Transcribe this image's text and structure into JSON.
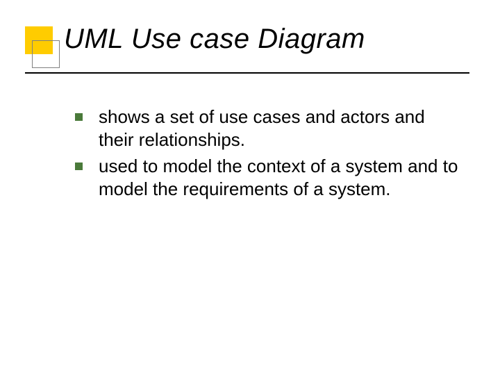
{
  "slide": {
    "title": "UML Use case Diagram",
    "bullets": [
      "shows a set of use cases and actors and their relationships.",
      "used to model the context of a system and to model the requirements of a system."
    ]
  }
}
